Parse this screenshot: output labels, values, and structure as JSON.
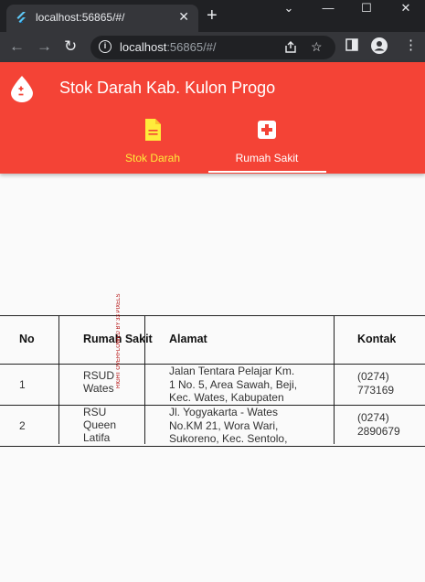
{
  "browser": {
    "tab_title": "localhost:56865/#/",
    "tab_close": "✕",
    "new_tab": "+",
    "url_host": "localhost",
    "url_rest": ":56865/#/",
    "window_controls": {
      "minimize": "—",
      "maximize": "☐",
      "close": "✕"
    }
  },
  "app": {
    "title": "Stok Darah Kab. Kulon Progo",
    "tabs": [
      {
        "label": "Stok Darah",
        "icon": "document-icon",
        "color": "#ffeb3b",
        "selected": false
      },
      {
        "label": "Rumah Sakit",
        "icon": "hospital-plus-icon",
        "color": "#ffffff",
        "selected": true
      }
    ],
    "colors": {
      "appbar": "#f44336",
      "indicator": "#ffffff"
    }
  },
  "table": {
    "headers": {
      "no": "No",
      "name": "Rumah Sakit",
      "address": "Alamat",
      "contact": "Kontak"
    },
    "rows": [
      {
        "no": "1",
        "name_lines": [
          "RSUD",
          "Wates"
        ],
        "address_lines": [
          "Jalan Tentara Pelajar Km.",
          "1 No. 5, Area Sawah, Beji,",
          "Kec. Wates, Kabupaten"
        ],
        "contact_lines": [
          "(0274)",
          "773169"
        ]
      },
      {
        "no": "2",
        "name_lines": [
          "RSU",
          "Queen",
          "Latifa"
        ],
        "address_lines": [
          "Jl. Yogyakarta - Wates",
          "No.KM 21, Wora Wari,",
          "Sukoreno, Kec. Sentolo,"
        ],
        "contact_lines": [
          "(0274)",
          "2890679"
        ]
      }
    ]
  },
  "overflow_warning": "RIGHT OVERFLOWED BY 33 PIXELS"
}
